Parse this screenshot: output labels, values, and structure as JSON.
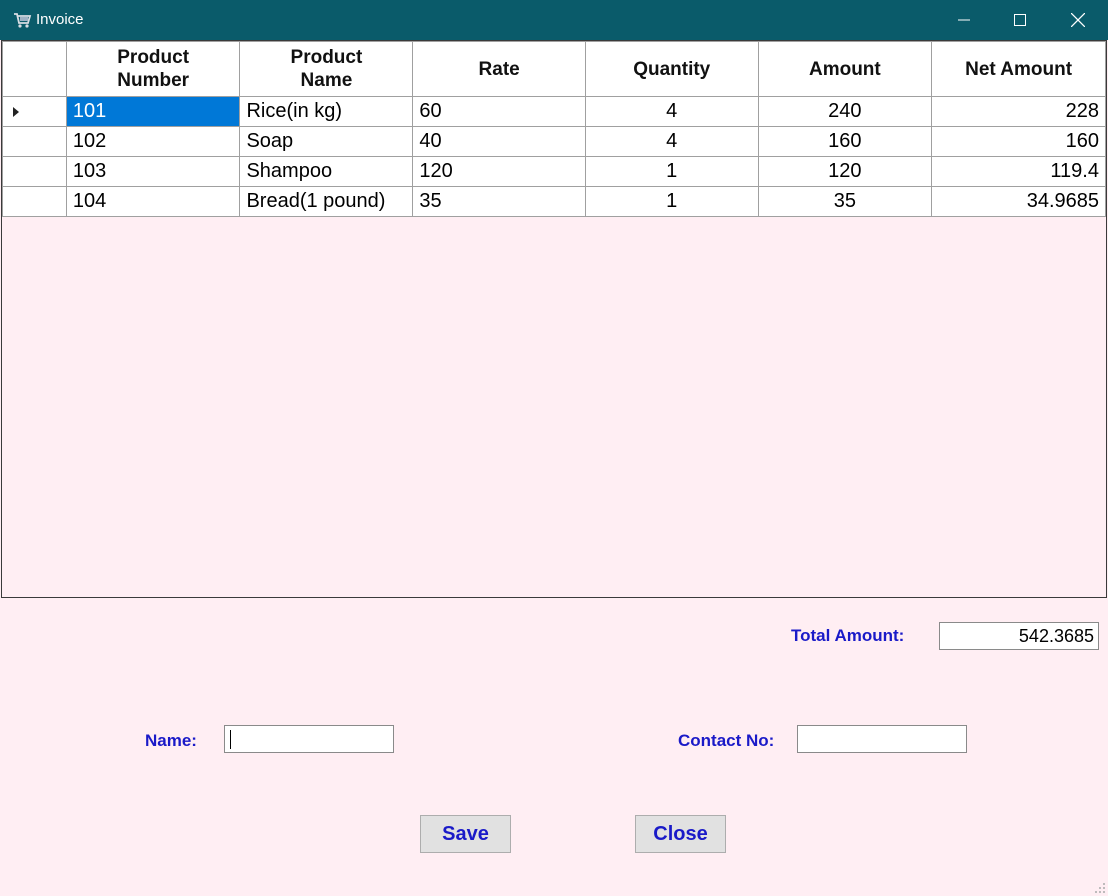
{
  "window": {
    "title": "Invoice"
  },
  "grid": {
    "headers": [
      "Product\nNumber",
      "Product\nName",
      "Rate",
      "Quantity",
      "Amount",
      "Net Amount"
    ],
    "rows": [
      [
        "101",
        "Rice(in kg)",
        "60",
        "4",
        "240",
        "228"
      ],
      [
        "102",
        "Soap",
        "40",
        "4",
        "160",
        "160"
      ],
      [
        "103",
        "Shampoo",
        "120",
        "1",
        "120",
        "119.4"
      ],
      [
        "104",
        "Bread(1 pound)",
        "35",
        "1",
        "35",
        "34.9685"
      ]
    ]
  },
  "total": {
    "label": "Total Amount:",
    "value": "542.3685"
  },
  "form": {
    "name_label": "Name:",
    "name_value": "",
    "contact_label": "Contact No:",
    "contact_value": ""
  },
  "buttons": {
    "save": "Save",
    "close": "Close"
  }
}
